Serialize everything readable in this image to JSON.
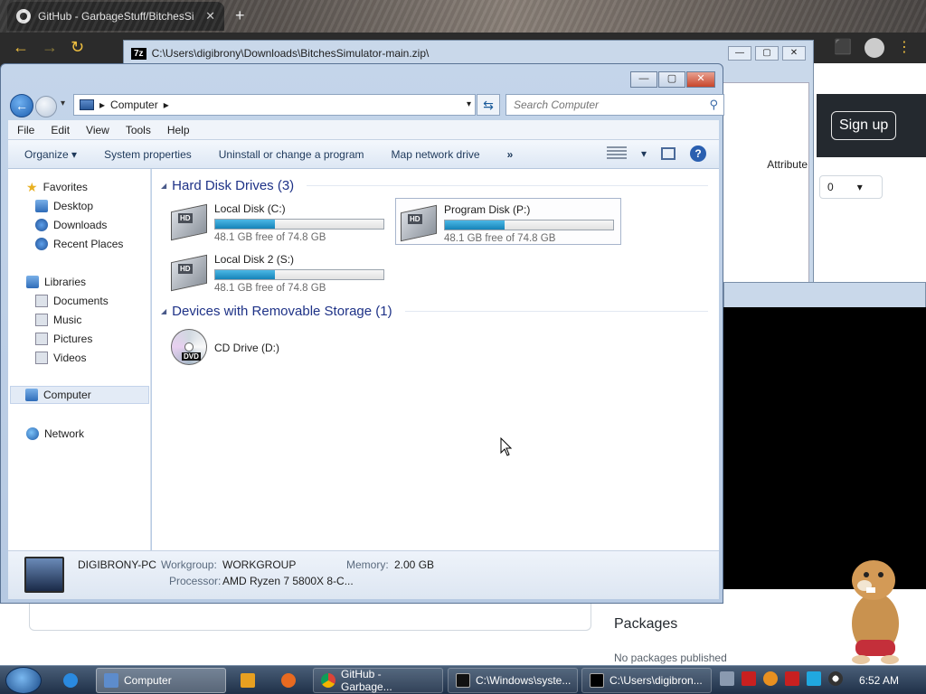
{
  "browser": {
    "tab_title": "GitHub - GarbageStuff/BitchesSi",
    "tab_close": "✕",
    "new_tab": "+",
    "back": "←",
    "forward": "→",
    "reload": "↻",
    "sign_up": "Sign up",
    "counter_value": "0",
    "attribute_header": "Attribute",
    "packages_title": "Packages",
    "no_packages": "No packages published"
  },
  "sevenzip": {
    "icon_label": "7z",
    "title": "C:\\Users\\digibrony\\Downloads\\BitchesSimulator-main.zip\\"
  },
  "explorer": {
    "controls": {
      "minimize": "—",
      "maximize": "▢",
      "close": "✕"
    },
    "address": {
      "crumb_root": "▸",
      "crumb": "Computer",
      "crumb_sep": "▸"
    },
    "search_placeholder": "Search Computer",
    "menu": [
      "File",
      "Edit",
      "View",
      "Tools",
      "Help"
    ],
    "commands": {
      "organize": "Organize ▾",
      "system_properties": "System properties",
      "uninstall": "Uninstall or change a program",
      "map_drive": "Map network drive",
      "more": "»"
    },
    "nav": {
      "favorites": "Favorites",
      "desktop": "Desktop",
      "downloads": "Downloads",
      "recent": "Recent Places",
      "libraries": "Libraries",
      "documents": "Documents",
      "music": "Music",
      "pictures": "Pictures",
      "videos": "Videos",
      "computer": "Computer",
      "network": "Network"
    },
    "groups": {
      "hdd": "Hard Disk Drives (3)",
      "removable": "Devices with Removable Storage (1)"
    },
    "drives": [
      {
        "name": "Local Disk (C:)",
        "free": "48.1 GB free of 74.8 GB",
        "used_fraction": 0.357,
        "icon_label": "HD"
      },
      {
        "name": "Program Disk (P:)",
        "free": "48.1 GB free of 74.8 GB",
        "used_fraction": 0.357,
        "icon_label": "HD"
      },
      {
        "name": "Local Disk 2 (S:)",
        "free": "48.1 GB free of 74.8 GB",
        "used_fraction": 0.357,
        "icon_label": "HD"
      }
    ],
    "cd": {
      "name": "CD Drive (D:)",
      "icon_label": "DVD"
    },
    "details": {
      "pc_name": "DIGIBRONY-PC",
      "workgroup_label": "Workgroup:",
      "workgroup": "WORKGROUP",
      "memory_label": "Memory:",
      "memory": "2.00 GB",
      "processor_label": "Processor:",
      "processor": "AMD Ryzen 7 5800X 8-C..."
    }
  },
  "taskbar": {
    "items": [
      {
        "label": "Computer"
      },
      {
        "label": "GitHub - Garbage..."
      },
      {
        "label": "C:\\Windows\\syste..."
      },
      {
        "label": "C:\\Users\\digibron..."
      }
    ],
    "clock": "6:52 AM"
  },
  "colors": {
    "selection_accent": "#1683b8",
    "group_header": "#1e3287",
    "close_button": "#c8452a"
  }
}
